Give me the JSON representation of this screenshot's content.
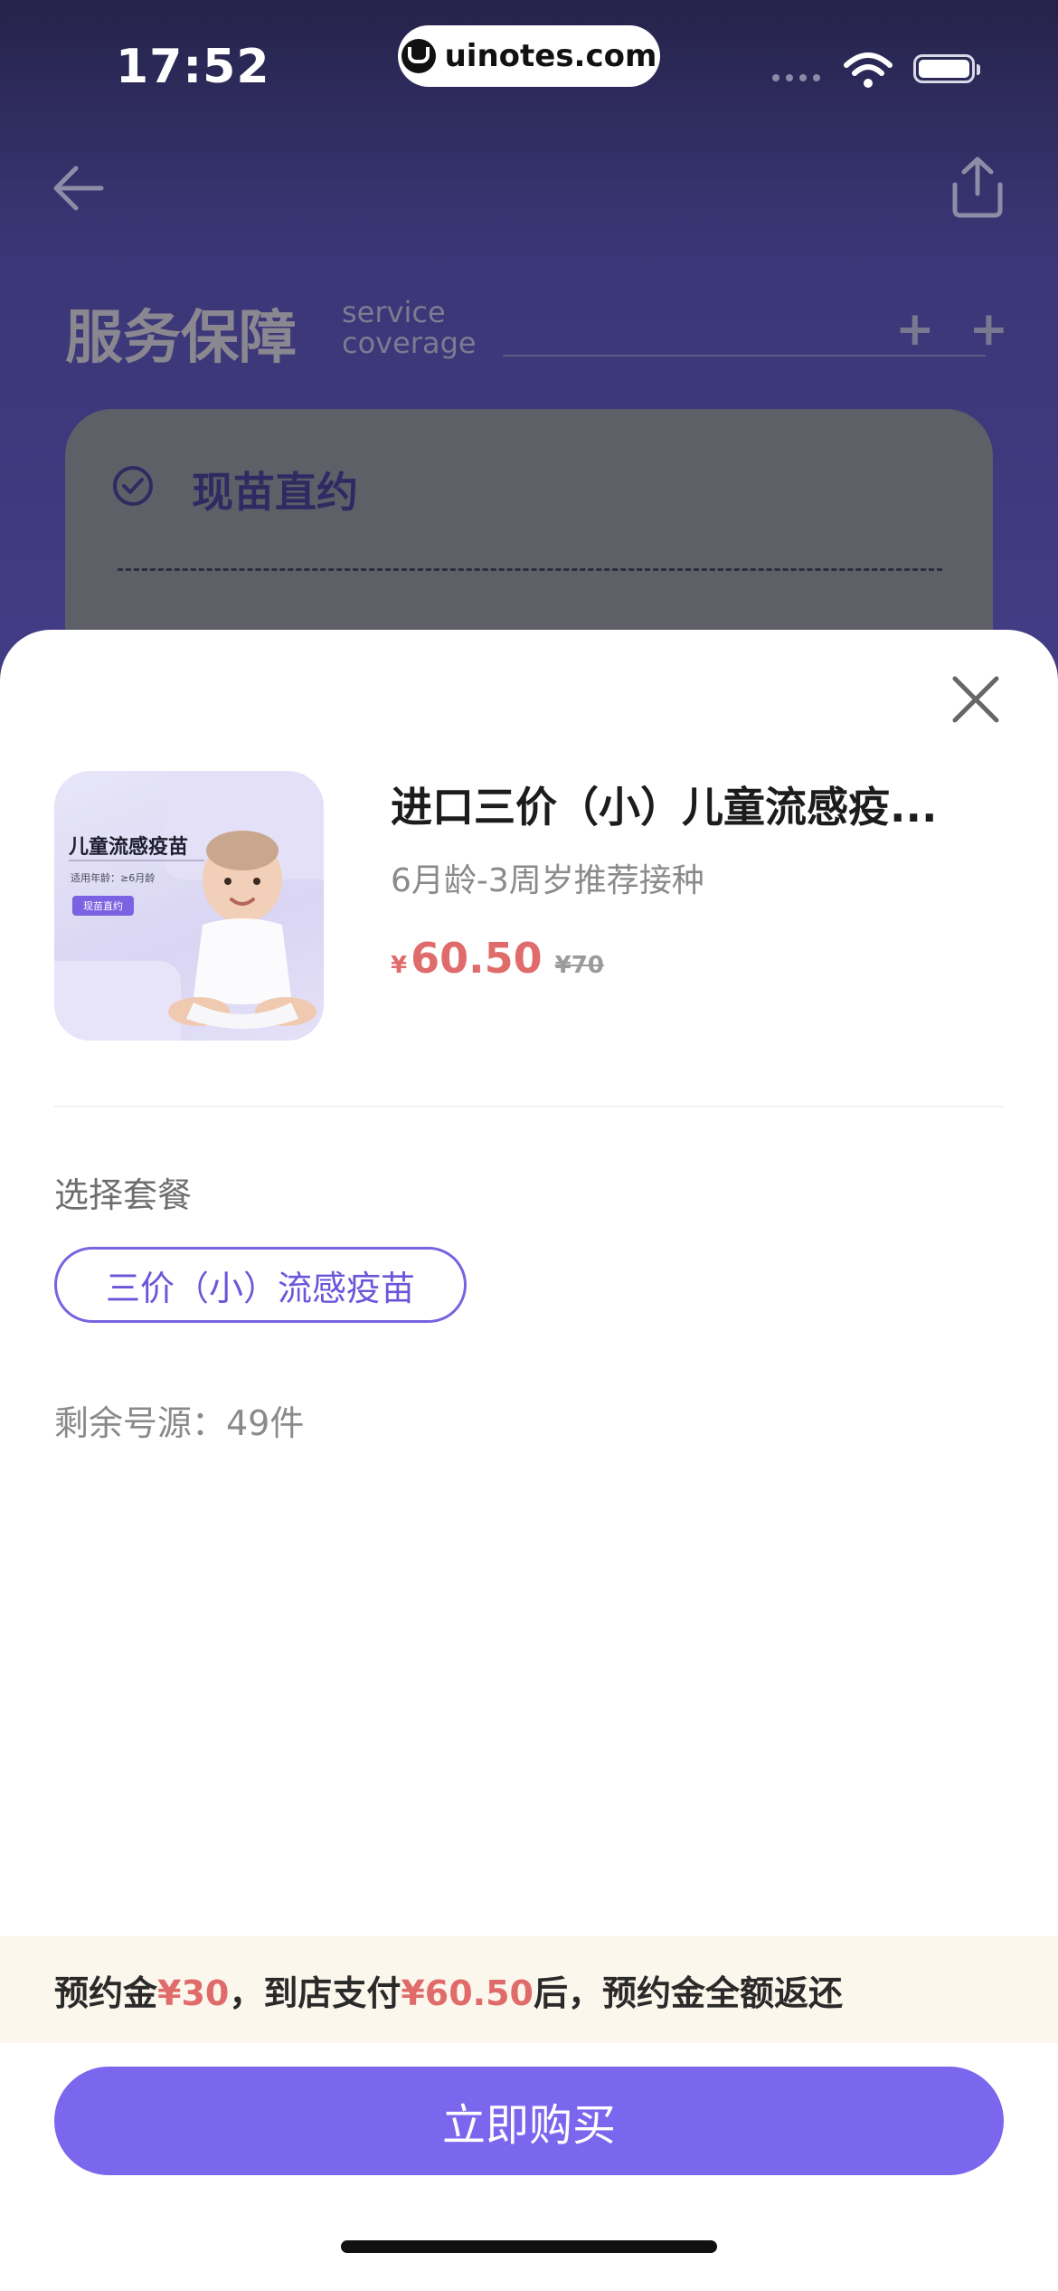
{
  "status_bar": {
    "time": "17:52",
    "watermark": "uinotes.com"
  },
  "nav": {
    "back_icon": "arrow-left-icon",
    "share_icon": "share-icon"
  },
  "background_section": {
    "title": "服务保障",
    "subtitle_line1": "service",
    "subtitle_line2": "coverage",
    "plus_marks": "+ +",
    "card_title": "现苗直约"
  },
  "sheet": {
    "close_icon": "close-icon",
    "product": {
      "image_title": "儿童流感疫苗",
      "image_sub": "适用年龄：≥6月龄",
      "image_tag": "现苗直约",
      "name": "进口三价（小）儿童流感疫...",
      "age": "6月龄-3周岁推荐接种",
      "currency": "¥",
      "price": "60.50",
      "original_price": "¥70"
    },
    "package_label": "选择套餐",
    "package_option": "三价（小）流感疫苗",
    "stock": "剩余号源：49件",
    "deposit": {
      "p1": "预约金",
      "amount": "¥30",
      "p2": "，到店支付",
      "pay": "¥60.50",
      "p3": "后，预约金全额返还"
    },
    "buy_label": "立即购买"
  },
  "colors": {
    "accent": "#7b67ee",
    "price_red": "#e06b6b",
    "deposit_bg": "#fcf7ec"
  }
}
